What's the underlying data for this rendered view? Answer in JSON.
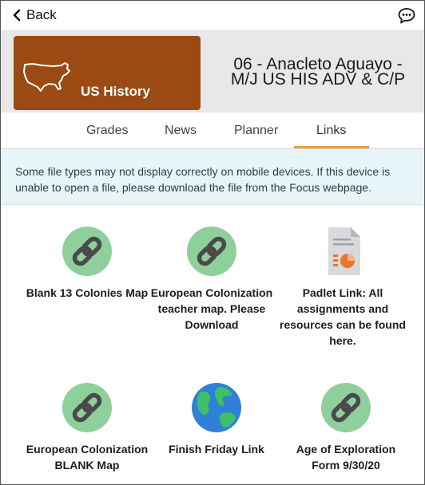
{
  "header": {
    "back_label": "Back"
  },
  "course": {
    "subject": "US History",
    "name": "06 - Anacleto Aguayo - M/J US HIS ADV & C/P",
    "tile_color": "#9a4a12"
  },
  "tabs": [
    {
      "label": "Grades",
      "active": false
    },
    {
      "label": "News",
      "active": false
    },
    {
      "label": "Planner",
      "active": false
    },
    {
      "label": "Links",
      "active": true
    }
  ],
  "notice": {
    "text": "Some file types may not display correctly on mobile devices. If this device is unable to open a file, please download the file from the Focus webpage."
  },
  "links": [
    {
      "title": "Blank 13 Colonies Map",
      "icon": "link-icon"
    },
    {
      "title": "European Colonization teacher map. Please Download",
      "icon": "link-icon"
    },
    {
      "title": "Padlet Link: All assignments and resources can be found here.",
      "icon": "document-chart-icon"
    },
    {
      "title": "European Colonization BLANK Map",
      "icon": "link-icon"
    },
    {
      "title": "Finish Friday Link",
      "icon": "globe-icon"
    },
    {
      "title": "Age of Exploration Form 9/30/20",
      "icon": "link-icon"
    }
  ],
  "colors": {
    "accent": "#f0a030",
    "link_circle": "#8fcf9c",
    "notice_bg": "#e7f4f8"
  }
}
